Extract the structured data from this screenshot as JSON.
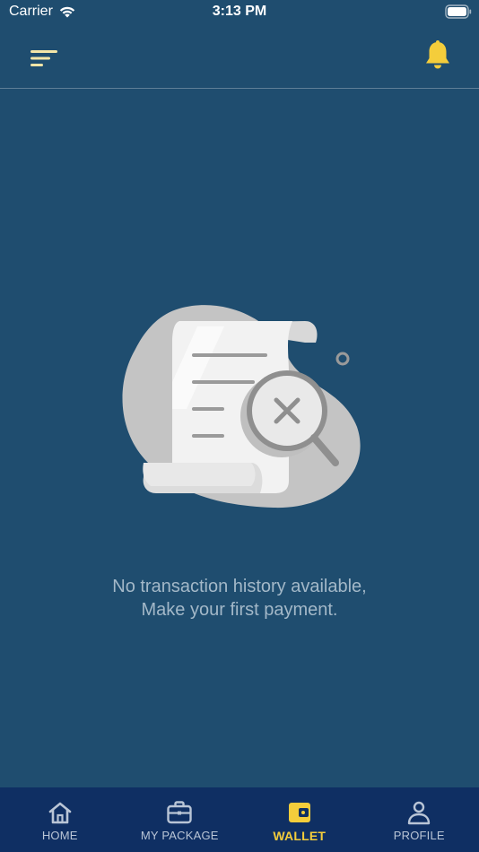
{
  "status_bar": {
    "carrier": "Carrier",
    "time": "3:13 PM"
  },
  "header": {
    "menu_icon": "menu-icon",
    "bell_icon": "bell-icon"
  },
  "empty_state": {
    "line1": "No transaction history available,",
    "line2": "Make your first payment.",
    "illustration_icon": "receipt-search-icon"
  },
  "nav": {
    "items": [
      {
        "label": "HOME",
        "icon": "home-icon"
      },
      {
        "label": "MY PACKAGE",
        "icon": "briefcase-icon"
      },
      {
        "label": "WALLET",
        "icon": "wallet-icon",
        "active": true
      },
      {
        "label": "PROFILE",
        "icon": "profile-icon"
      }
    ]
  },
  "colors": {
    "background": "#1f4d6f",
    "nav_background": "#0f2f63",
    "accent": "#f4cd3b",
    "inactive": "#b9c5d6"
  }
}
